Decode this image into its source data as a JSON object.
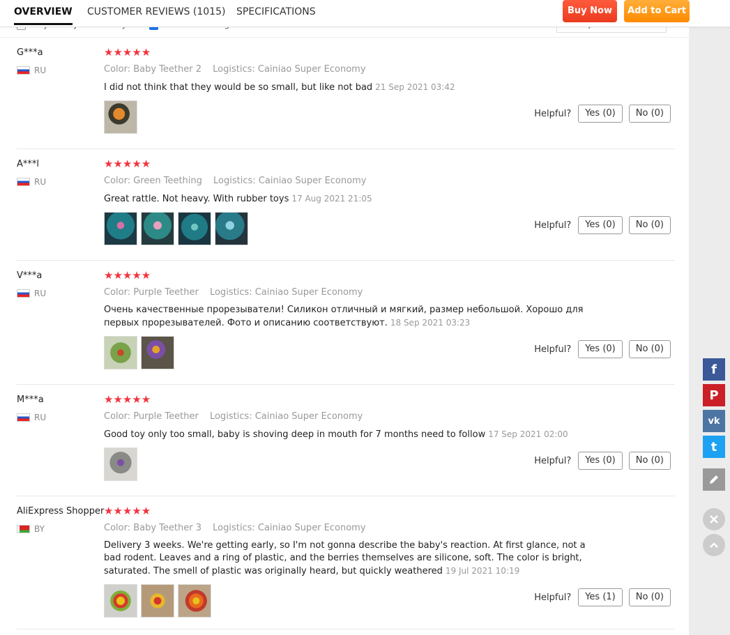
{
  "nav": {
    "tabs": [
      "OVERVIEW",
      "CUSTOMER REVIEWS (1015)",
      "SPECIFICATIONS"
    ],
    "buy_now": "Buy Now",
    "add_to_cart": "Add to Cart"
  },
  "filters": {
    "only_country": "Only from your country",
    "translate": "Translate to English",
    "sort": "Sort by default"
  },
  "helpful_label": "Helpful?",
  "reviews": [
    {
      "user": "G***a",
      "country": "RU",
      "stars": "★★★★★",
      "color": "Color: Baby Teether 2",
      "logistics": "Logistics: Cainiao Super Economy",
      "text": "I did not think that they would be so small, but like not bad",
      "date": "21 Sep 2021 03:42",
      "yes": "Yes (0)",
      "no": "No (0)"
    },
    {
      "user": "A***l",
      "country": "RU",
      "stars": "★★★★★",
      "color": "Color: Green Teething",
      "logistics": "Logistics: Cainiao Super Economy",
      "text": "Great rattle. Not heavy. With rubber toys",
      "date": "17 Aug 2021 21:05",
      "yes": "Yes (0)",
      "no": "No (0)"
    },
    {
      "user": "V***a",
      "country": "RU",
      "stars": "★★★★★",
      "color": "Color: Purple Teether",
      "logistics": "Logistics: Cainiao Super Economy",
      "text": "Очень качественные прорезыватели! Силикон отличный и мягкий, размер небольшой. Хорошо для первых прорезывателей. Фото и описанию соответствуют.",
      "date": "18 Sep 2021 03:23",
      "yes": "Yes (0)",
      "no": "No (0)"
    },
    {
      "user": "M***a",
      "country": "RU",
      "stars": "★★★★★",
      "color": "Color: Purple Teether",
      "logistics": "Logistics: Cainiao Super Economy",
      "text": "Good toy only too small, baby is shoving deep in mouth for 7 months need to follow",
      "date": "17 Sep 2021 02:00",
      "yes": "Yes (0)",
      "no": "No (0)"
    },
    {
      "user": "AliExpress Shopper",
      "country": "BY",
      "stars": "★★★★★",
      "color": "Color: Baby Teether 3",
      "logistics": "Logistics: Cainiao Super Economy",
      "text": "Delivery 3 weeks. We're getting early, so I'm not gonna describe the baby's reaction. At first glance, not a bad rodent. Leaves and a ring of plastic, and the berries themselves are silicone, soft. The color is bright, saturated. The smell of plastic was originally heard, but quickly weathered",
      "date": "19 Jul 2021 10:19",
      "yes": "Yes (1)",
      "no": "No (0)"
    }
  ],
  "social": {
    "facebook": "f",
    "pinterest": "P",
    "vk": "vk",
    "twitter": "t"
  }
}
